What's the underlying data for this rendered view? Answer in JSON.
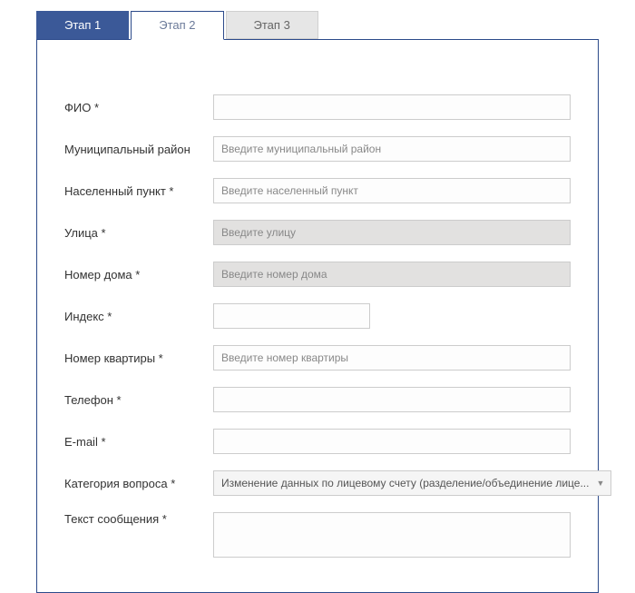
{
  "tabs": {
    "stage1": "Этап 1",
    "stage2": "Этап 2",
    "stage3": "Этап 3"
  },
  "form": {
    "fio": {
      "label": "ФИО *",
      "placeholder": "",
      "value": ""
    },
    "district": {
      "label": "Муниципальный район",
      "placeholder": "Введите муниципальный район",
      "value": ""
    },
    "locality": {
      "label": "Населенный пункт *",
      "placeholder": "Введите населенный пункт",
      "value": ""
    },
    "street": {
      "label": "Улица *",
      "placeholder": "Введите улицу",
      "value": ""
    },
    "house": {
      "label": "Номер дома *",
      "placeholder": "Введите номер дома",
      "value": ""
    },
    "index": {
      "label": "Индекс *",
      "placeholder": "",
      "value": ""
    },
    "apartment": {
      "label": "Номер квартиры *",
      "placeholder": "Введите номер квартиры",
      "value": ""
    },
    "phone": {
      "label": "Телефон *",
      "placeholder": "",
      "value": ""
    },
    "email": {
      "label": "E-mail *",
      "placeholder": "",
      "value": ""
    },
    "category": {
      "label": "Категория вопроса *",
      "selected": "Изменение данных по лицевому счету (разделение/объединение лице..."
    },
    "message": {
      "label": "Текст сообщения *",
      "placeholder": "",
      "value": ""
    }
  }
}
